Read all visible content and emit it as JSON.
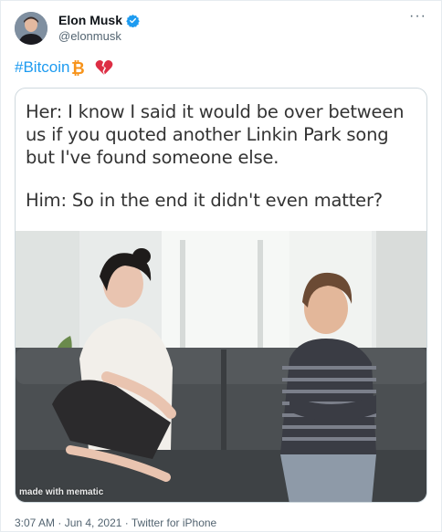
{
  "author": {
    "display_name": "Elon Musk",
    "handle": "@elonmusk",
    "verified_color": "#1d9bf0"
  },
  "tweet": {
    "hashtag": "#Bitcoin",
    "emojis": [
      "bitcoin-icon",
      "broken-heart-icon"
    ],
    "hashtag_color": "#1d9bf0"
  },
  "meme": {
    "her_line": "Her: I know I said it would be over between us if you quoted another Linkin Park song but I've found someone else.",
    "him_line": "Him: So in the end it didn't even matter?",
    "watermark": "made with mematic"
  },
  "meta": {
    "timestamp": "3:07 AM · Jun 4, 2021 · Twitter for iPhone"
  },
  "icons": {
    "more": "more-options-icon",
    "verified": "verified-badge-icon"
  }
}
